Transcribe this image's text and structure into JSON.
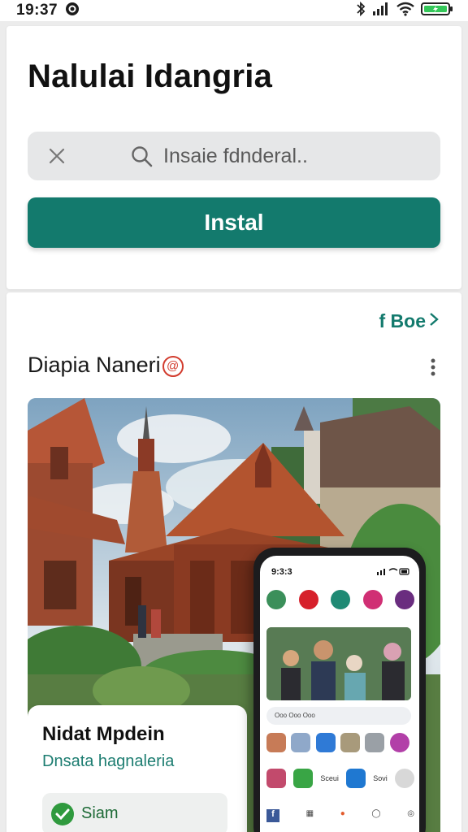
{
  "status_bar": {
    "time": "19:37",
    "battery_color": "#34c759"
  },
  "header": {
    "title": "Nalulai Idangria"
  },
  "search": {
    "placeholder": "Insaie fdnderal.."
  },
  "install": {
    "label": "Instal",
    "color": "#137a6d"
  },
  "section": {
    "see_more": "f Boe",
    "title": "Diapia Naneri",
    "badge": "@"
  },
  "info_card": {
    "title": "Nidat Mpdein",
    "subtitle": "Dnsata hagnaleria",
    "chip_label": "Siam"
  },
  "phone": {
    "time": "9:3:3",
    "search_text": "Ooo Ooo Ooo",
    "row2": [
      "Sceui",
      "Sovi"
    ],
    "accent": "#137a6d"
  }
}
